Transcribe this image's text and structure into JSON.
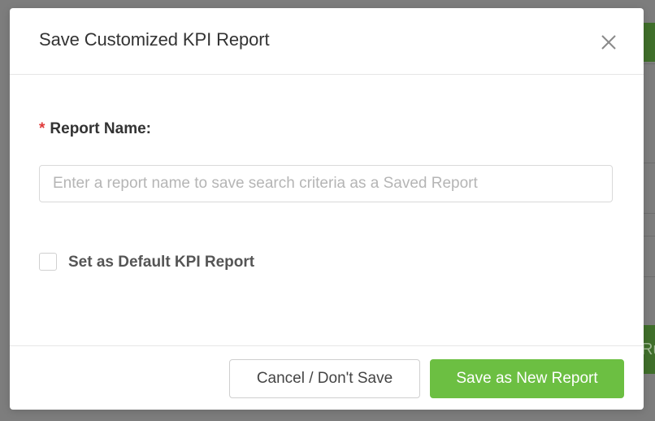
{
  "modal": {
    "title": "Save Customized KPI Report",
    "close_icon": "close-icon"
  },
  "form": {
    "required_marker": "*",
    "report_name_label": "Report Name:",
    "report_name_value": "",
    "report_name_placeholder": "Enter a report name to save search criteria as a Saved Report",
    "default_checkbox_label": "Set as Default KPI Report",
    "default_checkbox_checked": false
  },
  "footer": {
    "cancel_label": "Cancel / Don't Save",
    "save_label": "Save as New Report"
  },
  "background": {
    "partial_button_text": "Ru"
  },
  "colors": {
    "primary": "#6cbf42",
    "required": "#e03a3a",
    "overlay": "#7d7d7d"
  }
}
